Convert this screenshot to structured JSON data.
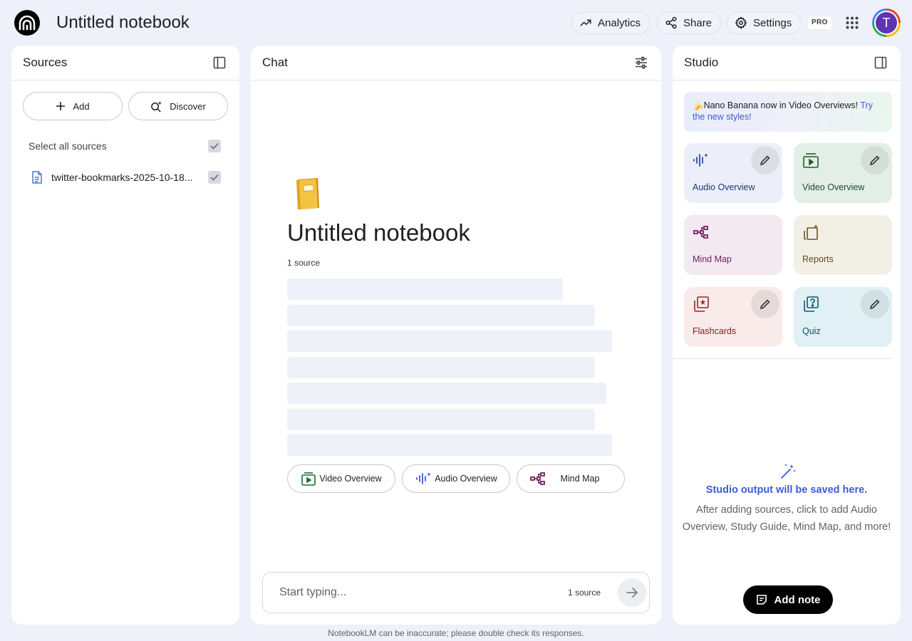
{
  "header": {
    "notebook_title": "Untitled notebook",
    "analytics_label": "Analytics",
    "share_label": "Share",
    "settings_label": "Settings",
    "plan_badge": "PRO",
    "avatar_initial": "T"
  },
  "sources": {
    "title": "Sources",
    "add_label": "Add",
    "discover_label": "Discover",
    "select_all_label": "Select all sources",
    "items": [
      {
        "name": "twitter-bookmarks-2025-10-18..."
      }
    ]
  },
  "chat": {
    "title": "Chat",
    "notebook_emoji": "📒",
    "notebook_title": "Untitled notebook",
    "source_count": "1 source",
    "quick_actions": [
      {
        "label": "Video Overview"
      },
      {
        "label": "Audio Overview"
      },
      {
        "label": "Mind Map"
      }
    ],
    "input_placeholder": "Start typing...",
    "input_source_count": "1 source"
  },
  "studio": {
    "title": "Studio",
    "banner_text": "🍌Nano Banana now in Video Overviews!",
    "banner_link": "Try the new styles!",
    "tiles": [
      {
        "label": "Audio Overview"
      },
      {
        "label": "Video Overview"
      },
      {
        "label": "Mind Map"
      },
      {
        "label": "Reports"
      },
      {
        "label": "Flashcards"
      },
      {
        "label": "Quiz"
      }
    ],
    "empty_title": "Studio output will be saved here.",
    "empty_text": "After adding sources, click to add Audio Overview, Study Guide, Mind Map, and more!",
    "add_note_label": "Add note"
  },
  "footer": {
    "disclaimer": "NotebookLM can be inaccurate; please double check its responses."
  }
}
